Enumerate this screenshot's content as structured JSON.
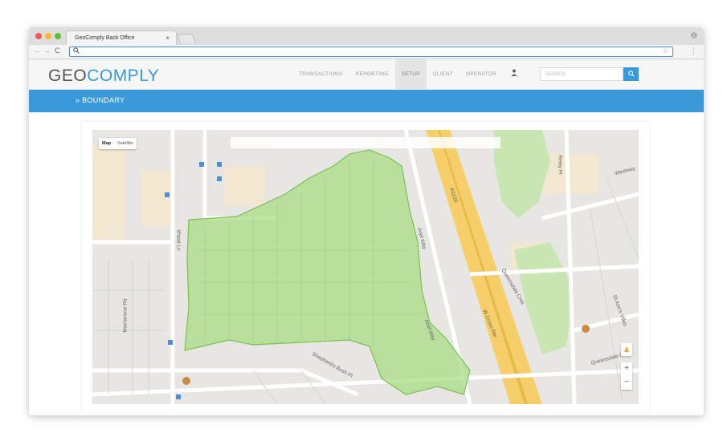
{
  "browser": {
    "tab_title": "GeoComply Back Office",
    "tab_close": "×",
    "address_placeholder": "",
    "nav_back": "←",
    "nav_forward": "→",
    "nav_reload": "C",
    "address_search_icon": "search-icon",
    "star": "☆",
    "menu": "⋮",
    "account": "⊖"
  },
  "app": {
    "logo_geo": "GEO",
    "logo_comply": "COMPLY",
    "nav": [
      {
        "label": "TRANSACTIONS",
        "active": false
      },
      {
        "label": "REPORTING",
        "active": false
      },
      {
        "label": "SETUP",
        "active": true
      },
      {
        "label": "CLIENT",
        "active": false
      },
      {
        "label": "OPERATOR",
        "active": false
      }
    ],
    "search_placeholder": "SEARCH",
    "search_button": "🔍",
    "accent_color": "#3a9ad9"
  },
  "page": {
    "breadcrumb": "» BOUNDARY"
  },
  "map": {
    "toggle_map": "Map",
    "toggle_satellite": "Satellite",
    "zoom_in": "+",
    "zoom_out": "−",
    "pegman": "♟",
    "labels": {
      "road_a3220": "A3220",
      "wood_ln": "Wood Ln",
      "macfarlane_rd": "Macfarlane Rd",
      "w_cross_rte": "W Cross Rte",
      "queensdale_cres": "Queensdale Cres",
      "queensdale_rd": "Queensdale Rd",
      "st_anns_villas": "St Ann's Villas",
      "shepherds_bush_pl": "Shepherd's Bush Pl",
      "holland_rd": "Wood Ln",
      "ariel_way_1": "Ariel Way",
      "ariel_way_2": "Ariel Way",
      "relay_pl": "Relay Pl",
      "westway": "Westway",
      "norland": "Norland"
    },
    "boundary_color": "#a9dc86"
  }
}
